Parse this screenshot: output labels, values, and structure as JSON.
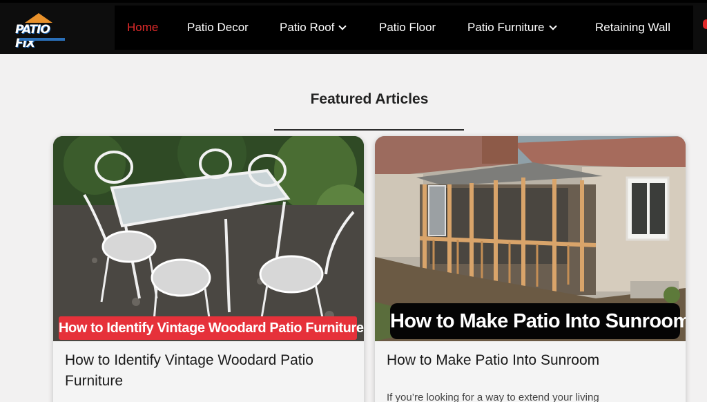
{
  "logo": {
    "text": "PATIO FIX"
  },
  "nav": {
    "items": [
      {
        "label": "Home",
        "active": true,
        "dropdown": false
      },
      {
        "label": "Patio Decor",
        "active": false,
        "dropdown": false
      },
      {
        "label": "Patio Roof",
        "active": false,
        "dropdown": true
      },
      {
        "label": "Patio Floor",
        "active": false,
        "dropdown": false
      },
      {
        "label": "Patio Furniture",
        "active": false,
        "dropdown": true
      },
      {
        "label": "Retaining Wall",
        "active": false,
        "dropdown": false
      }
    ]
  },
  "section": {
    "title": "Featured Articles"
  },
  "articles": [
    {
      "image_caption": "How to Identify Vintage Woodard Patio Furniture",
      "title": "How to Identify Vintage Woodard Patio Furniture",
      "excerpt": ""
    },
    {
      "image_caption": "How to Make Patio Into Sunroom",
      "title": "How to Make Patio Into Sunroom",
      "excerpt": "If you’re looking for a way to extend your living"
    }
  ],
  "colors": {
    "nav_bg": "#000000",
    "active": "#e02a2a",
    "page_bg": "#f2f1f1",
    "caption_red": "#e6313a"
  },
  "icons": [
    "logo-house-icon",
    "chevron-down-icon"
  ]
}
